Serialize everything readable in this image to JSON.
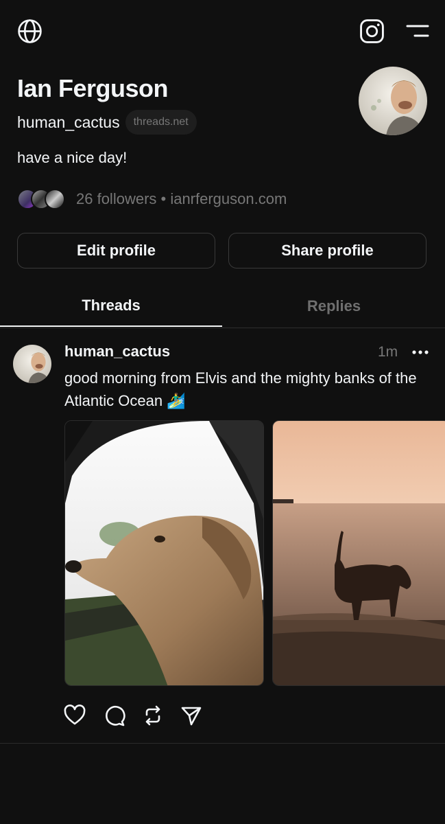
{
  "profile": {
    "name": "Ian Ferguson",
    "handle": "human_cactus",
    "domain_badge": "threads.net",
    "bio": "have a nice day!",
    "followers_text": "26 followers • ianrferguson.com"
  },
  "buttons": {
    "edit": "Edit profile",
    "share": "Share profile"
  },
  "tabs": [
    {
      "label": "Threads",
      "active": true
    },
    {
      "label": "Replies",
      "active": false
    }
  ],
  "post": {
    "user": "human_cactus",
    "time": "1m",
    "text": "good morning from Elvis and the mighty banks of the Atlantic Ocean 🏄‍♂️"
  },
  "icons": {
    "top_left": "globe-icon",
    "top_right_1": "instagram-icon",
    "top_right_2": "menu-icon",
    "actions": [
      "heart-icon",
      "comment-icon",
      "repost-icon",
      "send-icon"
    ]
  },
  "colors": {
    "background": "#101010",
    "text": "#f3f5f7",
    "muted": "#777777"
  }
}
